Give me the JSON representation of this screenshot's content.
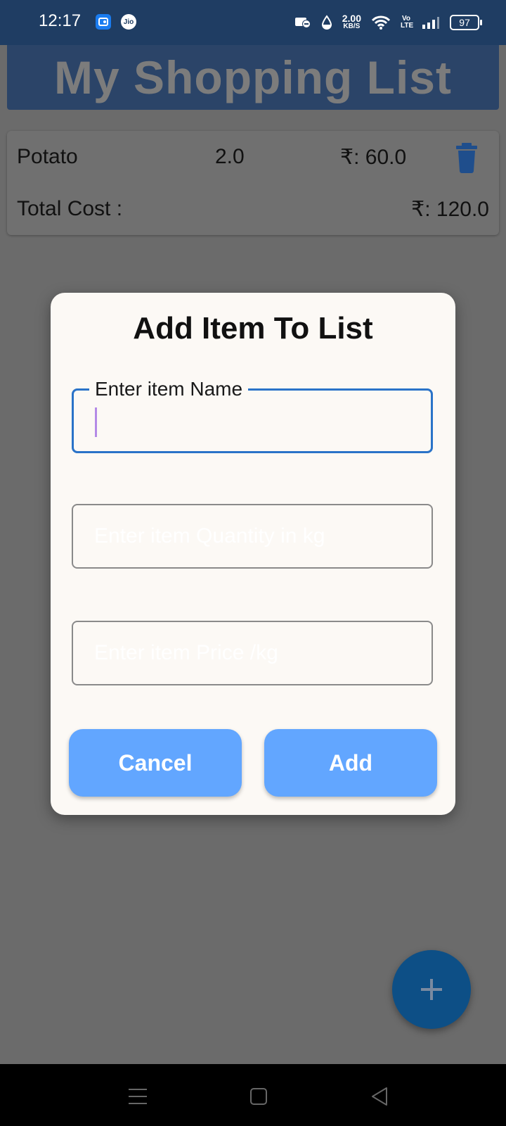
{
  "status_bar": {
    "time": "12:17",
    "network_speed": "2.00",
    "network_unit": "KB/S",
    "volte": "Vo LTE",
    "battery": "97",
    "jio_label": "Jio"
  },
  "app_bar": {
    "title": "My Shopping List"
  },
  "list": {
    "items": [
      {
        "name": "Potato",
        "quantity": "2.0",
        "price": "₹: 60.0"
      }
    ],
    "total_label": "Total Cost :",
    "total_value": "₹: 120.0"
  },
  "dialog": {
    "title": "Add Item To List",
    "name_field_label": "Enter item Name",
    "name_field_value": "",
    "quantity_placeholder": "Enter item Quantity in kg",
    "price_placeholder": "Enter item Price /kg",
    "cancel_label": "Cancel",
    "add_label": "Add"
  },
  "colors": {
    "status_bar_bg": "#1f3d63",
    "app_bar_bg": "#2b4468",
    "button_bg": "#62a6ff",
    "fab_bg": "#0d4f86",
    "focus_border": "#2a73c8",
    "delete_icon": "#1f4e8c"
  },
  "icons": {
    "delete": "trash-icon",
    "fab": "plus-icon",
    "nav": [
      "menu-icon",
      "home-icon",
      "back-icon"
    ]
  }
}
